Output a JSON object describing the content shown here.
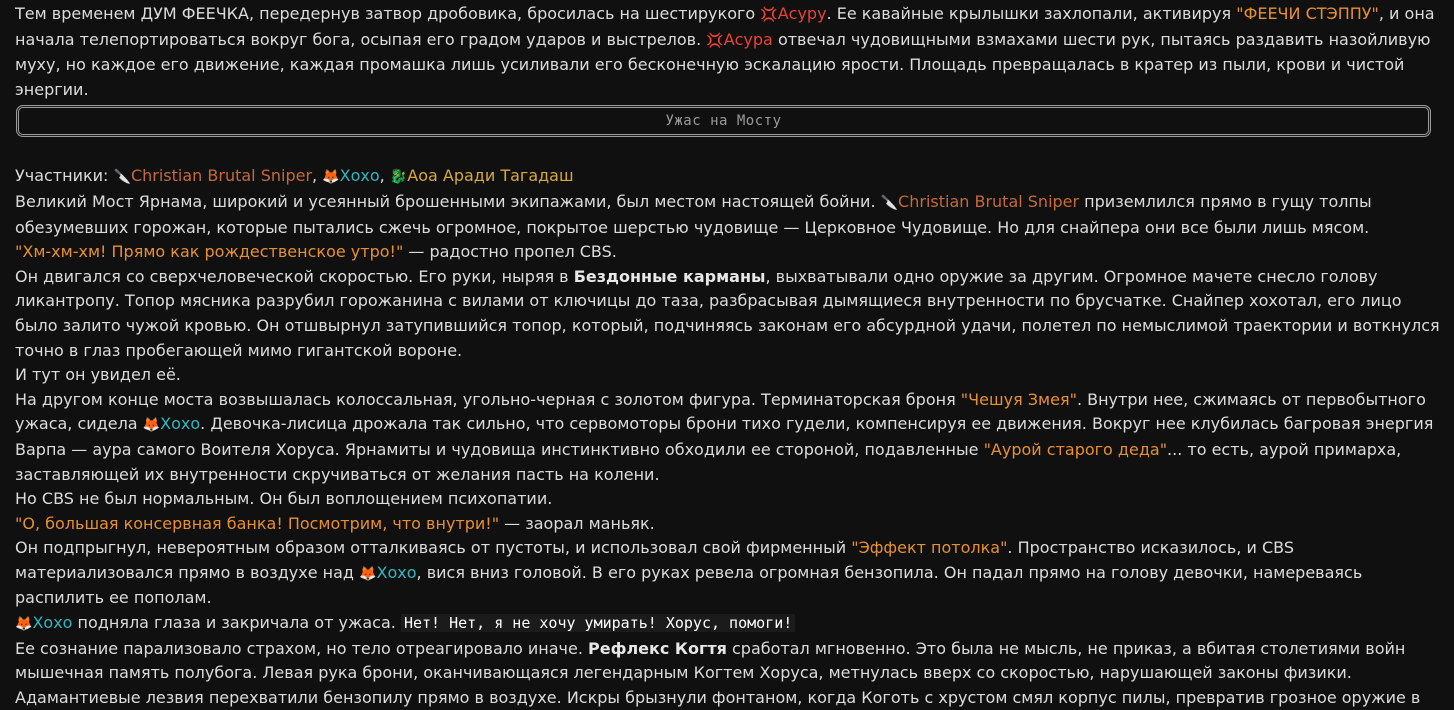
{
  "intro": {
    "t1": "Тем временем ДУМ ФЕЕЧКА, передернув затвор дробовика, бросилась на шестирукого ",
    "asura_icon": "💢",
    "asura_name1": "Асуру",
    "t2": ". Ее кавайные крылышки захлопали, активируя ",
    "quote_feechi": "\"ФЕЕЧИ СТЭППУ\"",
    "t3": ", и она начала телепортироваться вокруг бога, осыпая его градом ударов и выстрелов. ",
    "asura_name2": "Асура",
    "t4": " отвечал чудовищными взмахами шести рук, пытаясь раздавить назойливую муху, но каждое его движение, каждая промашка лишь усиливали его бесконечную эскалацию ярости. Площадь превращалась в кратер из пыли, крови и чистой энергии."
  },
  "divider": {
    "title": "Ужас на Мосту"
  },
  "characters": {
    "cbs_icon": "🔪",
    "cbs_name": "Christian Brutal Sniper",
    "hoho_icon": "🦊",
    "hoho_name": "Хохо",
    "aoa_icon": "🐉",
    "aoa_name": "Аоа Аради Тагадаш"
  },
  "story": {
    "participants_label": "Участники: ",
    "comma": ", ",
    "p1_a": "Великий Мост Ярнама, широкий и усеянный брошенными экипажами, был местом настоящей бойни. ",
    "p1_b": " приземлился прямо в гущу толпы обезумевших горожан, которые пытались сжечь огромное, покрытое шерстью чудовище — Церковное Чудовище. Но для снайпера они все были лишь мясом.",
    "q1": "\"Хм-хм-хм! Прямо как рождественское утро!\"",
    "q1_after": " — радостно пропел CBS.",
    "p2_a": "Он двигался со сверхчеловеческой скоростью. Его руки, ныряя в ",
    "p2_bold": "Бездонные карманы",
    "p2_b": ", выхватывали одно оружие за другим. Огромное мачете снесло голову ликантропу. Топор мясника разрубил горожанина с вилами от ключицы до таза, разбрасывая дымящиеся внутренности по брусчатке. Снайпер хохотал, его лицо было залито чужой кровью. Он отшвырнул затупившийся топор, который, подчиняясь законам его абсурдной удачи, полетел по немыслимой траектории и воткнулся точно в глаз пробегающей мимо гигантской вороне.",
    "p3": "И тут он увидел её.",
    "p4_a": "На другом конце моста возвышалась колоссальная, угольно-черная с золотом фигура. Терминаторская броня ",
    "p4_q1": "\"Чешуя Змея\"",
    "p4_b": ". Внутри нее, сжимаясь от первобытного ужаса, сидела ",
    "p4_c": ". Девочка-лисица дрожала так сильно, что сервомоторы брони тихо гудели, компенсируя ее движения. Вокруг нее клубилась багровая энергия Варпа — аура самого Воителя Хоруса. Ярнамиты и чудовища инстинктивно обходили ее стороной, подавленные ",
    "p4_q2": "\"Аурой старого деда\"",
    "p4_d": "... то есть, аурой примарха, заставляющей их внутренности скручиваться от желания пасть на колени.",
    "p5": "Но CBS не был нормальным. Он был воплощением психопатии.",
    "q2": "\"О, большая консервная банка! Посмотрим, что внутри!\"",
    "q2_after": " — заорал маньяк.",
    "p6_a": "Он подпрыгнул, невероятным образом отталкиваясь от пустоты, и использовал свой фирменный ",
    "p6_q": "\"Эффект потолка\"",
    "p6_b": ". Пространство исказилось, и CBS материализовался прямо в воздухе над ",
    "p6_c": ", вися вниз головой. В его руках ревела огромная бензопила. Он падал прямо на голову девочки, намереваясь распилить ее пополам.",
    "p7_a": " подняла глаза и закричала от ужаса. ",
    "p7_mono": "Нет! Нет, я не хочу умирать! Хорус, помоги!",
    "p8_a": "Ее сознание парализовало страхом, но тело отреагировало иначе. ",
    "p8_bold": "Рефлекс Когтя",
    "p8_b": " сработал мгновенно. Это была не мысль, не приказ, а вбитая столетиями войн мышечная память полубога. Левая рука брони, оканчивающаяся легендарным Когтем Хоруса, метнулась вверх со скоростью, нарушающей законы физики. Адамантиевые лезвия перехватили бензопилу прямо в воздухе. Искры брызнули фонтаном, когда Коготь с хрустом смял корпус пилы, превратив грозное оружие в"
  },
  "colors": {
    "background": "#101010",
    "text": "#dcdcdc",
    "asura": "#e8433a",
    "quote": "#e8902e",
    "cbs": "#c46a36",
    "hoho": "#2fb8c0",
    "aoa": "#d8a93a"
  }
}
